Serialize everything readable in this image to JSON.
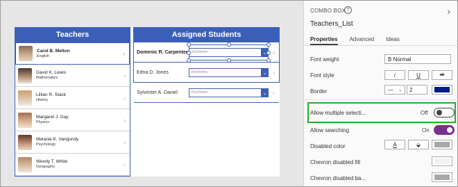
{
  "canvas": {
    "teachers": {
      "header": "Teachers",
      "items": [
        {
          "name": "Carol B. Melton",
          "subject": "English"
        },
        {
          "name": "David K. Lewis",
          "subject": "Mathematics"
        },
        {
          "name": "Lillian R. Stack",
          "subject": "History"
        },
        {
          "name": "Margaret J. Gay",
          "subject": "Physics"
        },
        {
          "name": "Melanie K. Vangundy",
          "subject": "Psychology"
        },
        {
          "name": "Wendy T. White",
          "subject": "Geography"
        }
      ]
    },
    "students": {
      "header": "Assigned Students",
      "placeholder": "Find items",
      "items": [
        {
          "name": "Domenic R. Carpenter"
        },
        {
          "name": "Edna D. Jones"
        },
        {
          "name": "Sylvester A. Daniel"
        }
      ]
    },
    "chevron": "›",
    "combo_arrow": "⌄"
  },
  "pane": {
    "type_label": "COMBO BOX",
    "help_glyph": "?",
    "close_glyph": "›",
    "control_name": "Teachers_List",
    "tabs": [
      "Properties",
      "Advanced",
      "Ideas"
    ],
    "props": {
      "font_weight": {
        "label": "Font weight",
        "value": "B  Normal"
      },
      "font_style": {
        "label": "Font style",
        "italic": "/",
        "underline": "U",
        "strike": "ab"
      },
      "border": {
        "label": "Border",
        "style_glyph": "—",
        "caret": "⌄",
        "width": "2",
        "color": "#001a8a"
      },
      "allow_multiple": {
        "label": "Allow multiple selecti...",
        "state": "Off"
      },
      "allow_searching": {
        "label": "Allow searching",
        "state": "On"
      },
      "disabled_color": {
        "label": "Disabled color",
        "text_glyph": "A",
        "fill_glyph": "⬙"
      },
      "chevron_disabled_fill": {
        "label": "Chevron disabled fill"
      },
      "chevron_disabled_bg": {
        "label": "Chevron disabled ba..."
      }
    },
    "colors": {
      "accent": "#7b2f8e",
      "highlight": "#22b022",
      "header_blue": "#3b5fb8"
    }
  }
}
